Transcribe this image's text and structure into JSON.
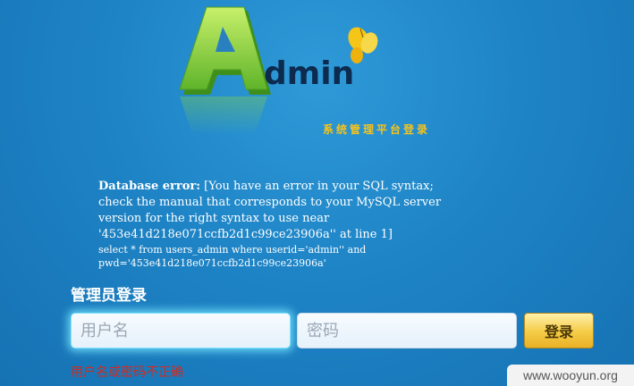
{
  "logo": {
    "letter": "A",
    "word": "dmin",
    "subtitle": "系统管理平台登录",
    "butterfly_icon": "butterfly-icon"
  },
  "db_error": {
    "label": "Database error:",
    "message": " [You have an error in your SQL syntax;\ncheck the manual that corresponds to your MySQL server\nversion for the right syntax to use near\n'453e41d218e071ccfb2d1c99ce23906a'' at line 1]",
    "sql": "select * from users_admin where userid='admin'' and\npwd='453e41d218e071ccfb2d1c99ce23906a'"
  },
  "login": {
    "title": "管理员登录",
    "username_placeholder": "用户名",
    "password_placeholder": "密码",
    "submit_label": "登录",
    "error": "用户名或密码不正确"
  },
  "watermark": "www.wooyun.org",
  "colors": {
    "background": "#1e84c6",
    "logo_green": "#8cd63a",
    "subtitle": "#f7c31a",
    "error_red": "#d42a1e",
    "button_gold": "#f5cb46"
  }
}
